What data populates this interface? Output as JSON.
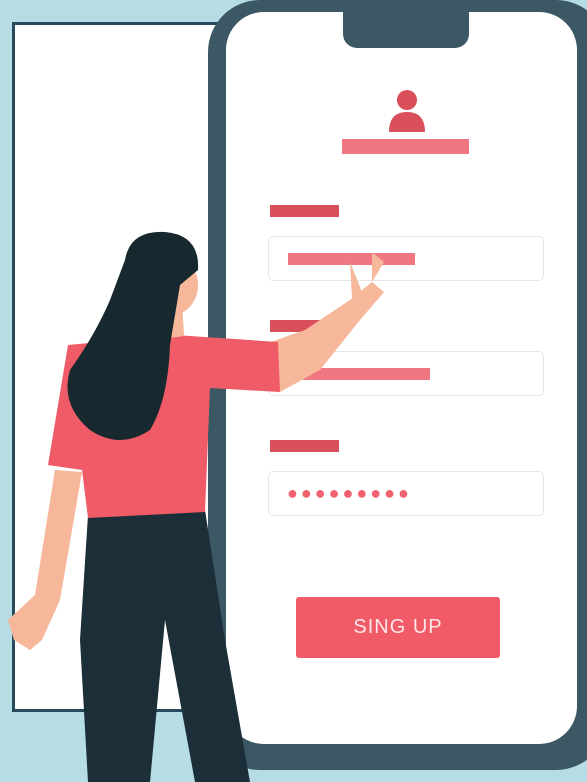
{
  "form": {
    "password_mask": "●●●●●●●●●",
    "signup_label": "SING UP"
  },
  "colors": {
    "background": "#b6dde4",
    "phone_frame": "#3b5864",
    "accent": "#f05b67",
    "label": "#d94f5c",
    "placeholder": "#f07681"
  },
  "icons": {
    "avatar": "user-icon"
  }
}
